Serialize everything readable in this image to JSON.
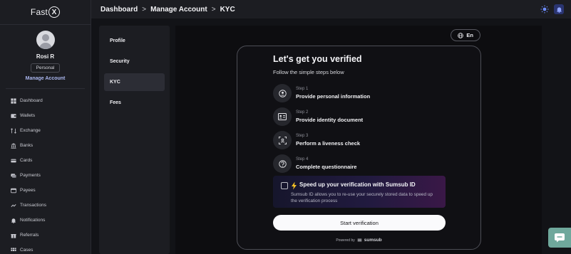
{
  "brand": {
    "name_prefix": "Fast",
    "name_mark": "X"
  },
  "user": {
    "name": "Rosi R",
    "account_type": "Personal",
    "manage_link": "Manage Account"
  },
  "sidebar": {
    "items": [
      {
        "label": "Dashboard",
        "icon": "dashboard-icon"
      },
      {
        "label": "Wallets",
        "icon": "wallet-icon"
      },
      {
        "label": "Exchange",
        "icon": "exchange-icon"
      },
      {
        "label": "Banks",
        "icon": "bank-icon"
      },
      {
        "label": "Cards",
        "icon": "card-icon"
      },
      {
        "label": "Payments",
        "icon": "payments-icon"
      },
      {
        "label": "Payees",
        "icon": "payees-icon"
      },
      {
        "label": "Transactions",
        "icon": "transactions-icon"
      },
      {
        "label": "Notifications",
        "icon": "bell-icon"
      },
      {
        "label": "Referrals",
        "icon": "gift-icon"
      },
      {
        "label": "Cases",
        "icon": "cases-icon"
      }
    ]
  },
  "header": {
    "breadcrumb": [
      "Dashboard",
      "Manage Account",
      "KYC"
    ],
    "separator": ">"
  },
  "tabs": [
    {
      "label": "Profile",
      "active": false
    },
    {
      "label": "Security",
      "active": false
    },
    {
      "label": "KYC",
      "active": true
    },
    {
      "label": "Fees",
      "active": false
    }
  ],
  "language": "En",
  "verification": {
    "title": "Let's get you verified",
    "subtitle": "Follow the simple steps below",
    "steps": [
      {
        "number": "Step 1",
        "label": "Provide personal information",
        "icon": "user-circle-icon"
      },
      {
        "number": "Step 2",
        "label": "Provide identity document",
        "icon": "id-card-icon"
      },
      {
        "number": "Step 3",
        "label": "Perform a liveness check",
        "icon": "face-scan-icon"
      },
      {
        "number": "Step 4",
        "label": "Complete questionnaire",
        "icon": "question-icon"
      }
    ],
    "promo": {
      "title": "Speed up your verification with Sumsub ID",
      "description": "Sumsub ID allows you to re-use your securely stored data to speed up the verification process"
    },
    "start_button": "Start verification",
    "powered_by": "Powered by",
    "powered_brand": "sumsub"
  },
  "colors": {
    "accent": "#aab6ee",
    "chat": "#6fa89c",
    "promo_end": "#3a1847"
  }
}
